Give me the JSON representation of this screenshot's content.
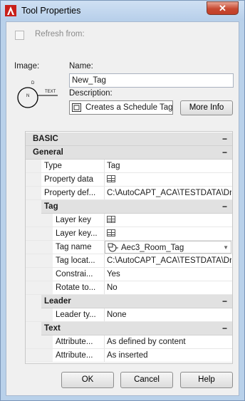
{
  "window": {
    "title": "Tool Properties",
    "close_glyph": "✕"
  },
  "refresh": {
    "label": "Refresh from:",
    "checked": false
  },
  "image_label": "Image:",
  "preview": {
    "text": "TEXT",
    "tag_top": "D",
    "tag_center": "N"
  },
  "name_field": {
    "label": "Name:",
    "value": "New_Tag"
  },
  "description": {
    "label": "Description:",
    "value": "Creates a Schedule Tag",
    "icon": "schedule-tag-icon"
  },
  "more_info_button": "More Info",
  "grid": {
    "basic": {
      "label": "BASIC",
      "toggle": "−"
    },
    "general": {
      "label": "General",
      "toggle": "−",
      "rows": [
        {
          "name": "Type",
          "value": "Tag"
        },
        {
          "name": "Property data",
          "value": "",
          "icon": "table-icon"
        },
        {
          "name": "Property def...",
          "value": "C:\\AutoCAPT_ACA\\TESTDATA\\Dr..."
        }
      ]
    },
    "tag": {
      "label": "Tag",
      "toggle": "−",
      "rows": [
        {
          "name": "Layer key",
          "value": "",
          "icon": "table-icon"
        },
        {
          "name": "Layer key...",
          "value": "",
          "icon": "table-icon"
        },
        {
          "name": "Tag name",
          "value": "Aec3_Room_Tag",
          "icon": "tag-style-icon",
          "dropdown": true
        },
        {
          "name": "Tag locat...",
          "value": "C:\\AutoCAPT_ACA\\TESTDATA\\Dr..."
        },
        {
          "name": "Constrai...",
          "value": "Yes"
        },
        {
          "name": "Rotate to...",
          "value": "No"
        }
      ]
    },
    "leader": {
      "label": "Leader",
      "toggle": "−",
      "rows": [
        {
          "name": "Leader ty...",
          "value": "None"
        }
      ]
    },
    "text": {
      "label": "Text",
      "toggle": "−",
      "rows": [
        {
          "name": "Attribute...",
          "value": "As defined by content"
        },
        {
          "name": "Attribute...",
          "value": "As inserted"
        }
      ]
    }
  },
  "buttons": {
    "ok": "OK",
    "cancel": "Cancel",
    "help": "Help"
  },
  "colors": {
    "accent": "#b9d1ea",
    "close": "#c74a32",
    "category_bg": "#e1e1e1"
  }
}
